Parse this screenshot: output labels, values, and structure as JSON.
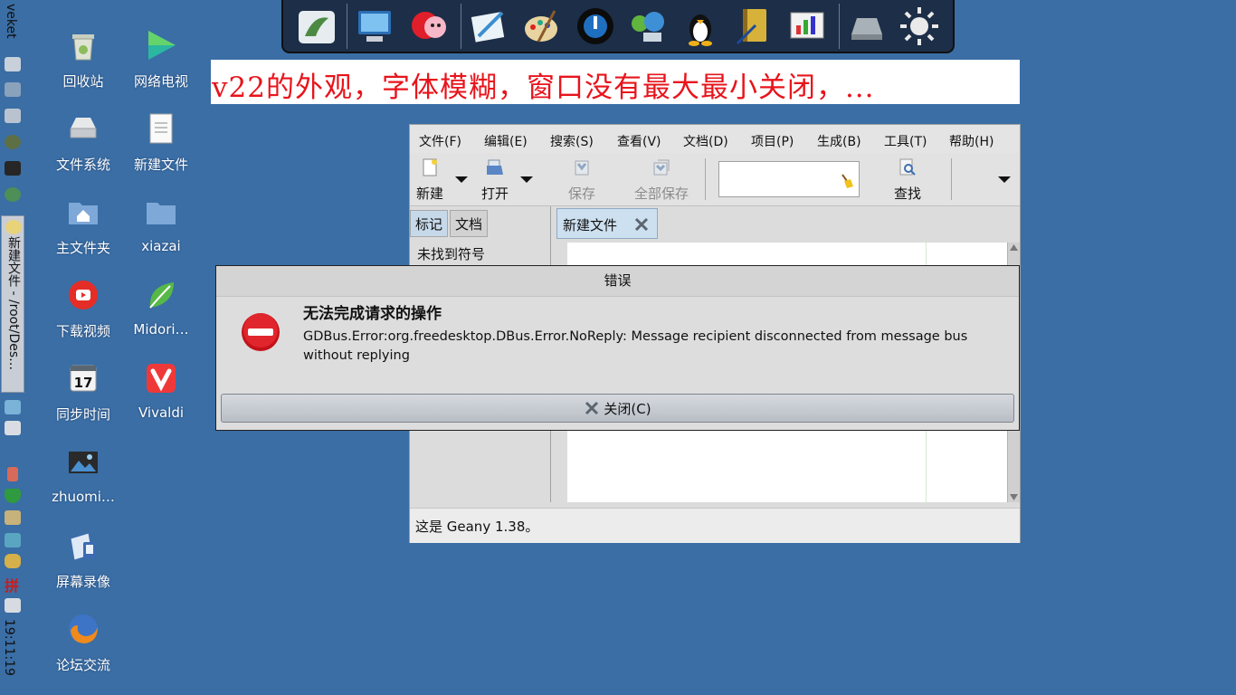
{
  "taskbar": {
    "app_name": "veket",
    "window_task": "新建文件 - /root/Des…",
    "input_method": "拼",
    "clock": "19:11:19"
  },
  "dock": {
    "icons": [
      "drawing-app-icon",
      "computer-icon",
      "pet-cat-icon",
      "text-editor-icon",
      "paint-icon",
      "media-player-icon",
      "network-icon",
      "linux-penguin-icon",
      "notebook-icon",
      "presentation-icon",
      "drive-icon",
      "weather-sun-icon"
    ]
  },
  "desktop": {
    "icons": [
      {
        "label": "回收站"
      },
      {
        "label": "网络电视"
      },
      {
        "label": "文件系统"
      },
      {
        "label": "新建文件"
      },
      {
        "label": "主文件夹"
      },
      {
        "label": "xiazai"
      },
      {
        "label": "下载视频"
      },
      {
        "label": "Midori…"
      },
      {
        "label": "同步时间"
      },
      {
        "label": "Vivaldi"
      },
      {
        "label": "zhuomi…"
      },
      {
        "label": "屏幕录像"
      },
      {
        "label": "论坛交流"
      }
    ],
    "calendar_day": "17"
  },
  "annotation": {
    "text": "v22的外观，字体模糊，窗口没有最大最小关闭，...",
    "color": "#e8141c"
  },
  "geany": {
    "menu": [
      "文件(F)",
      "编辑(E)",
      "搜索(S)",
      "查看(V)",
      "文档(D)",
      "项目(P)",
      "生成(B)",
      "工具(T)",
      "帮助(H)"
    ],
    "toolbar": {
      "new_label": "新建",
      "open_label": "打开",
      "save_label": "保存",
      "save_all_label": "全部保存",
      "find_label": "查找",
      "search_value": ""
    },
    "sidebar": {
      "tab_symbols": "标记",
      "tab_documents": "文档",
      "empty_text": "未找到符号"
    },
    "editor_tab": "新建文件",
    "status": "这是 Geany 1.38。"
  },
  "dialog": {
    "title": "错误",
    "heading": "无法完成请求的操作",
    "message": "GDBus.Error:org.freedesktop.DBus.Error.NoReply: Message recipient disconnected from message bus without replying",
    "close_label": "关闭(C)",
    "accent": "#d8141c"
  }
}
